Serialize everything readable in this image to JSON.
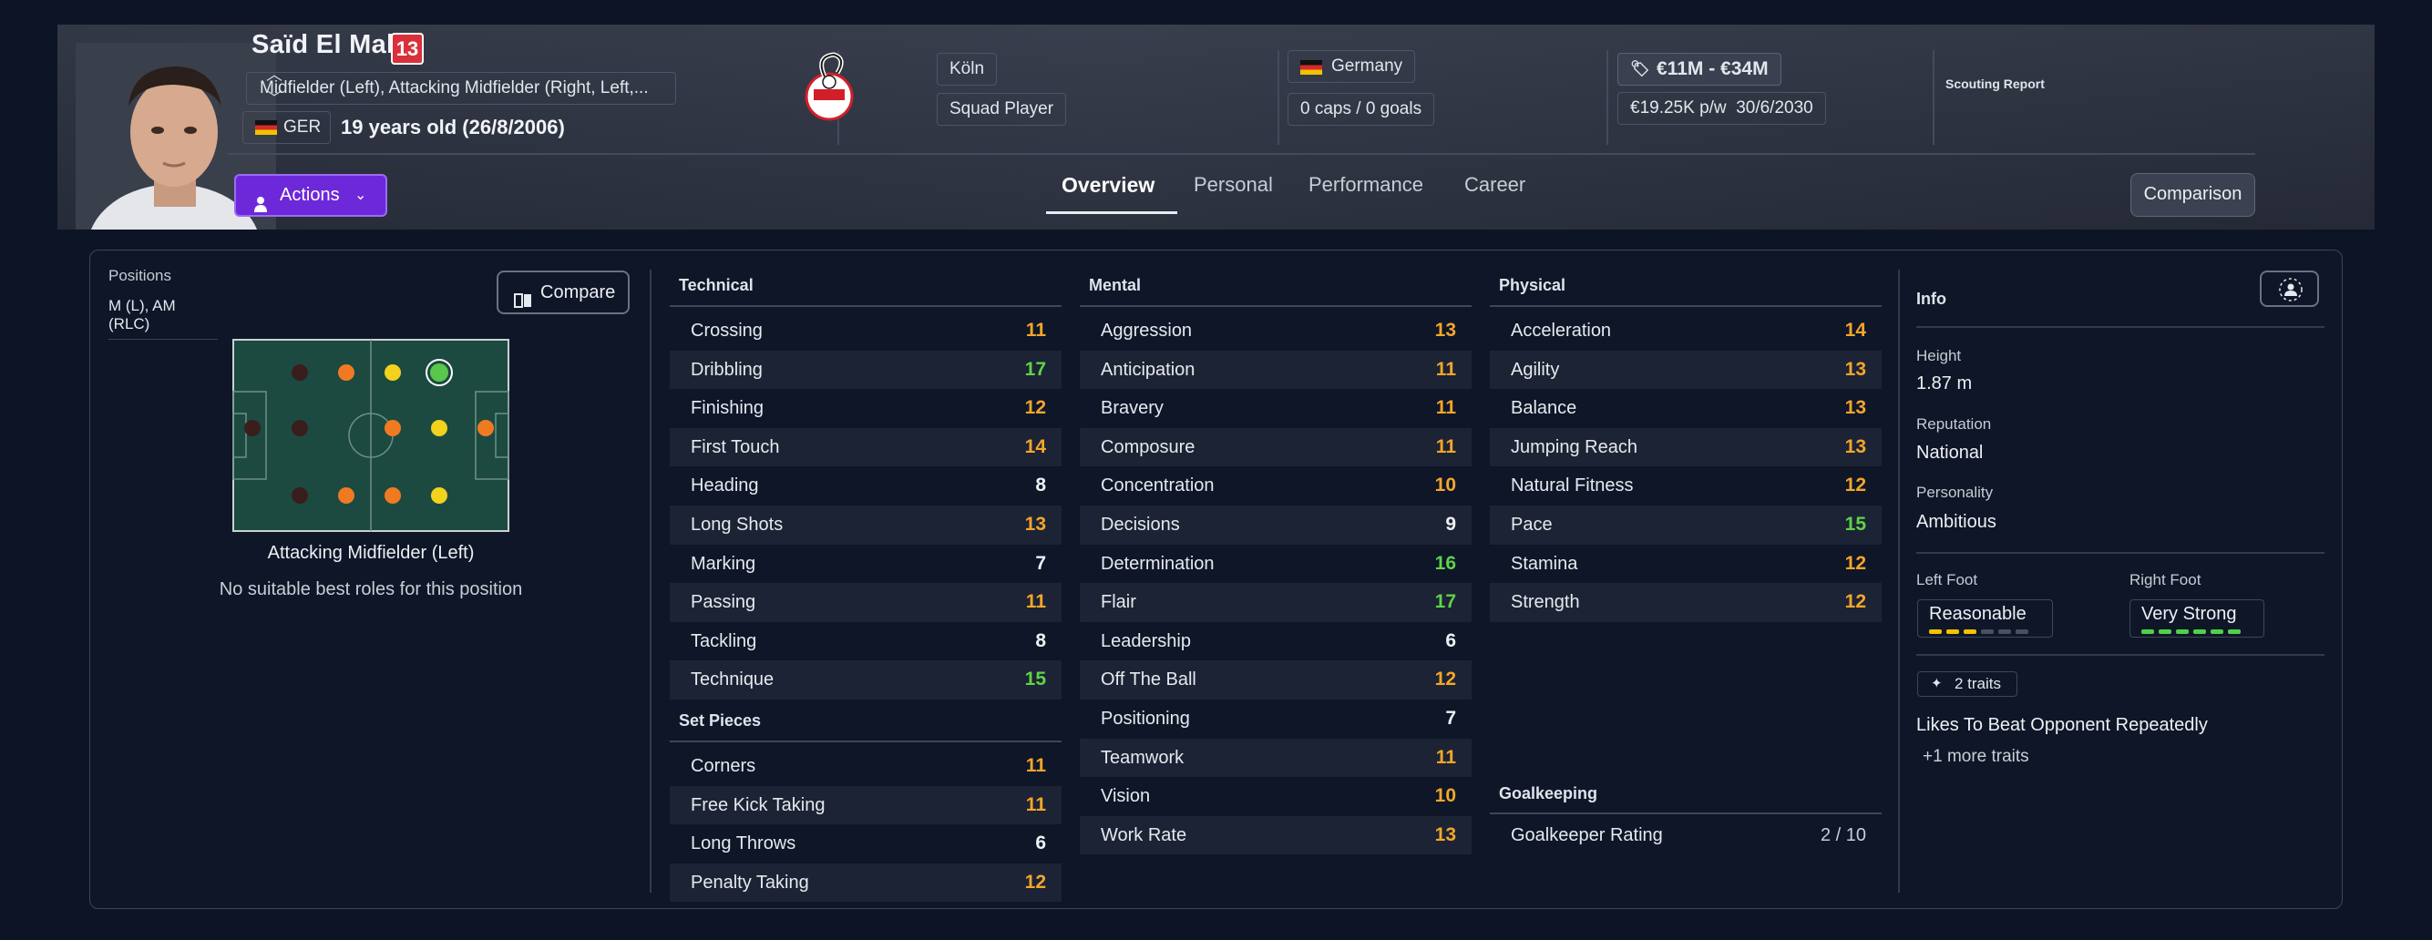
{
  "player": {
    "name": "Saïd El Mala",
    "shirt_number": "13",
    "positions_text": "Midfielder (Left), Attacking Midfielder (Right, Left,...",
    "nationality_code": "GER",
    "age_text": "19 years old (26/8/2006)"
  },
  "club": {
    "name": "Köln",
    "status": "Squad Player"
  },
  "nation": {
    "name": "Germany",
    "caps_goals": "0 caps / 0 goals"
  },
  "contract": {
    "value_range": "€11M - €34M",
    "wage": "€19.25K p/w",
    "expires": "30/6/2030"
  },
  "scouting_report_label": "Scouting Report",
  "actions_label": "Actions",
  "tabs": [
    {
      "label": "Overview",
      "active": true
    },
    {
      "label": "Personal",
      "active": false
    },
    {
      "label": "Performance",
      "active": false
    },
    {
      "label": "Career",
      "active": false
    }
  ],
  "comparison_label": "Comparison",
  "positions_panel": {
    "label": "Positions",
    "value": "M (L), AM (RLC)",
    "compare_label": "Compare",
    "role_title": "Attacking Midfielder (Left)",
    "role_sub": "No suitable best roles for this position"
  },
  "technical": {
    "title": "Technical",
    "attrs": [
      {
        "name": "Crossing",
        "value": "11",
        "tone": "orange"
      },
      {
        "name": "Dribbling",
        "value": "17",
        "tone": "green"
      },
      {
        "name": "Finishing",
        "value": "12",
        "tone": "orange"
      },
      {
        "name": "First Touch",
        "value": "14",
        "tone": "orange"
      },
      {
        "name": "Heading",
        "value": "8",
        "tone": "white"
      },
      {
        "name": "Long Shots",
        "value": "13",
        "tone": "orange"
      },
      {
        "name": "Marking",
        "value": "7",
        "tone": "white"
      },
      {
        "name": "Passing",
        "value": "11",
        "tone": "orange"
      },
      {
        "name": "Tackling",
        "value": "8",
        "tone": "white"
      },
      {
        "name": "Technique",
        "value": "15",
        "tone": "green"
      }
    ]
  },
  "set_pieces": {
    "title": "Set Pieces",
    "attrs": [
      {
        "name": "Corners",
        "value": "11",
        "tone": "orange"
      },
      {
        "name": "Free Kick Taking",
        "value": "11",
        "tone": "orange"
      },
      {
        "name": "Long Throws",
        "value": "6",
        "tone": "white"
      },
      {
        "name": "Penalty Taking",
        "value": "12",
        "tone": "orange"
      }
    ]
  },
  "mental": {
    "title": "Mental",
    "attrs": [
      {
        "name": "Aggression",
        "value": "13",
        "tone": "orange"
      },
      {
        "name": "Anticipation",
        "value": "11",
        "tone": "orange"
      },
      {
        "name": "Bravery",
        "value": "11",
        "tone": "orange"
      },
      {
        "name": "Composure",
        "value": "11",
        "tone": "orange"
      },
      {
        "name": "Concentration",
        "value": "10",
        "tone": "orange"
      },
      {
        "name": "Decisions",
        "value": "9",
        "tone": "white"
      },
      {
        "name": "Determination",
        "value": "16",
        "tone": "green"
      },
      {
        "name": "Flair",
        "value": "17",
        "tone": "green"
      },
      {
        "name": "Leadership",
        "value": "6",
        "tone": "white"
      },
      {
        "name": "Off The Ball",
        "value": "12",
        "tone": "orange"
      },
      {
        "name": "Positioning",
        "value": "7",
        "tone": "white"
      },
      {
        "name": "Teamwork",
        "value": "11",
        "tone": "orange"
      },
      {
        "name": "Vision",
        "value": "10",
        "tone": "orange"
      },
      {
        "name": "Work Rate",
        "value": "13",
        "tone": "orange"
      }
    ]
  },
  "physical": {
    "title": "Physical",
    "attrs": [
      {
        "name": "Acceleration",
        "value": "14",
        "tone": "orange"
      },
      {
        "name": "Agility",
        "value": "13",
        "tone": "orange"
      },
      {
        "name": "Balance",
        "value": "13",
        "tone": "orange"
      },
      {
        "name": "Jumping Reach",
        "value": "13",
        "tone": "orange"
      },
      {
        "name": "Natural Fitness",
        "value": "12",
        "tone": "orange"
      },
      {
        "name": "Pace",
        "value": "15",
        "tone": "green"
      },
      {
        "name": "Stamina",
        "value": "12",
        "tone": "orange"
      },
      {
        "name": "Strength",
        "value": "12",
        "tone": "orange"
      }
    ]
  },
  "goalkeeping": {
    "title": "Goalkeeping",
    "attrs": [
      {
        "name": "Goalkeeper Rating",
        "value": "2 / 10",
        "tone": "gk"
      }
    ]
  },
  "info": {
    "title": "Info",
    "height_label": "Height",
    "height": "1.87 m",
    "reputation_label": "Reputation",
    "reputation": "National",
    "personality_label": "Personality",
    "personality": "Ambitious",
    "left_foot_label": "Left Foot",
    "left_foot": "Reasonable",
    "left_foot_level": 3,
    "right_foot_label": "Right Foot",
    "right_foot": "Very Strong",
    "right_foot_level": 6,
    "traits_count": "2 traits",
    "trait_main": "Likes To Beat Opponent Repeatedly",
    "trait_more": "+1 more traits"
  },
  "colors": {
    "accent_purple": "#6d28d9",
    "attr_green": "#5fd348",
    "attr_orange": "#f4a62a",
    "foot_yellow": "#f2c200",
    "foot_green": "#4fd14a"
  },
  "pitch_dots": [
    {
      "tone": "dark"
    },
    {
      "tone": "orange"
    },
    {
      "tone": "yellow"
    },
    {
      "tone": "green"
    },
    {
      "tone": "dark"
    },
    {
      "tone": "dark"
    },
    {
      "tone": "orange"
    },
    {
      "tone": "yellow"
    },
    {
      "tone": "orange"
    },
    {
      "tone": "dark"
    },
    {
      "tone": "orange"
    },
    {
      "tone": "orange"
    },
    {
      "tone": "yellow"
    }
  ]
}
